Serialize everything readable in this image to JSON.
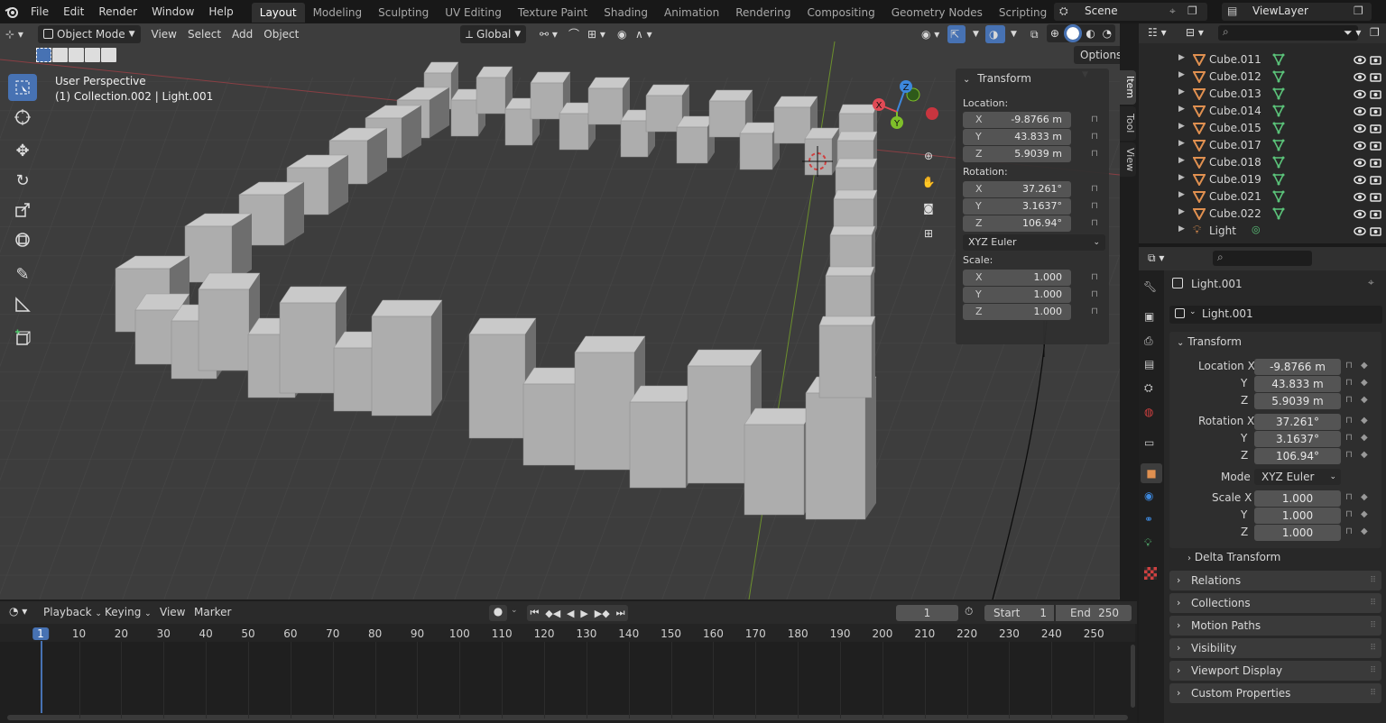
{
  "topbar": {
    "menus": [
      "File",
      "Edit",
      "Render",
      "Window",
      "Help"
    ],
    "workspaces": [
      "Layout",
      "Modeling",
      "Sculpting",
      "UV Editing",
      "Texture Paint",
      "Shading",
      "Animation",
      "Rendering",
      "Compositing",
      "Geometry Nodes",
      "Scripting"
    ],
    "active_workspace": "Layout",
    "add_tab": "+",
    "scene_name": "Scene",
    "view_layer": "ViewLayer"
  },
  "viewport": {
    "mode": "Object Mode",
    "menus": [
      "View",
      "Select",
      "Add",
      "Object"
    ],
    "orientation": "Global",
    "options_label": "Options",
    "info_line1": "User Perspective",
    "info_line2": "(1) Collection.002 | Light.001",
    "gizmo": {
      "x": "X",
      "y": "Y",
      "z": "Z"
    }
  },
  "npanel": {
    "title": "Transform",
    "location_label": "Location:",
    "rotation_label": "Rotation:",
    "scale_label": "Scale:",
    "axes": [
      "X",
      "Y",
      "Z"
    ],
    "location": [
      "-9.8766 m",
      "43.833 m",
      "5.9039 m"
    ],
    "rotation": [
      "37.261°",
      "3.1637°",
      "106.94°"
    ],
    "rotation_mode": "XYZ Euler",
    "scale": [
      "1.000",
      "1.000",
      "1.000"
    ],
    "tabs": [
      "Item",
      "Tool",
      "View"
    ]
  },
  "outliner": {
    "items": [
      {
        "name": "Cube.011",
        "type": "mesh"
      },
      {
        "name": "Cube.012",
        "type": "mesh"
      },
      {
        "name": "Cube.013",
        "type": "mesh"
      },
      {
        "name": "Cube.014",
        "type": "mesh"
      },
      {
        "name": "Cube.015",
        "type": "mesh"
      },
      {
        "name": "Cube.017",
        "type": "mesh"
      },
      {
        "name": "Cube.018",
        "type": "mesh"
      },
      {
        "name": "Cube.019",
        "type": "mesh"
      },
      {
        "name": "Cube.021",
        "type": "mesh"
      },
      {
        "name": "Cube.022",
        "type": "mesh"
      },
      {
        "name": "Light",
        "type": "light"
      }
    ]
  },
  "properties": {
    "object_name": "Light.001",
    "data_name": "Light.001",
    "transform_title": "Transform",
    "location_x_label": "Location X",
    "rotation_x_label": "Rotation X",
    "scale_x_label": "Scale X",
    "y_label": "Y",
    "z_label": "Z",
    "mode_label": "Mode",
    "location": [
      "-9.8766 m",
      "43.833 m",
      "5.9039 m"
    ],
    "rotation": [
      "37.261°",
      "3.1637°",
      "106.94°"
    ],
    "rotation_mode": "XYZ Euler",
    "scale": [
      "1.000",
      "1.000",
      "1.000"
    ],
    "delta_transform": "Delta Transform",
    "sections": [
      "Relations",
      "Collections",
      "Motion Paths",
      "Visibility",
      "Viewport Display",
      "Custom Properties"
    ]
  },
  "timeline": {
    "menus": [
      "Playback",
      "Keying",
      "View",
      "Marker"
    ],
    "current_frame": "1",
    "start_label": "Start",
    "start_value": "1",
    "end_label": "End",
    "end_value": "250",
    "ruler": [
      "1",
      "10",
      "20",
      "30",
      "40",
      "50",
      "60",
      "70",
      "80",
      "90",
      "100",
      "110",
      "120",
      "130",
      "140",
      "150",
      "160",
      "170",
      "180",
      "190",
      "200",
      "210",
      "220",
      "230",
      "240",
      "250"
    ]
  },
  "colors": {
    "accent": "#4772b3",
    "mesh_icon": "#e09050",
    "object_data_icon": "#5bc47a",
    "axis_x": "#e04a55",
    "axis_y": "#7fbf2a",
    "axis_z": "#3d88dd"
  }
}
